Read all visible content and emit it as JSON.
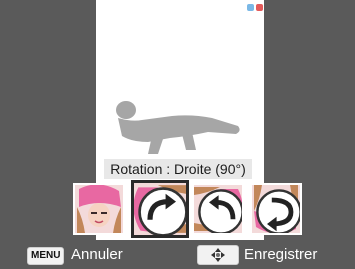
{
  "rotation": {
    "caption": "Rotation : Droite (90°)",
    "selected_index": 1,
    "thumbnails": [
      {
        "name": "thumb-original",
        "rotation": 0,
        "icon": "none"
      },
      {
        "name": "thumb-rotate-right",
        "rotation": 90,
        "icon": "rotate-right-icon"
      },
      {
        "name": "thumb-rotate-left",
        "rotation": -90,
        "icon": "rotate-left-icon"
      },
      {
        "name": "thumb-rotate-180",
        "rotation": 180,
        "icon": "rotate-180-icon"
      }
    ]
  },
  "footer": {
    "menu_key": "MENU",
    "cancel_label": "Annuler",
    "navigate_key_icon": "dpad-icon",
    "save_label": "Enregistrer"
  },
  "colors": {
    "side_panel": "#5a5a5a",
    "preview_bg": "#ffffff",
    "selected_border": "#2a2a2a",
    "accent_corner_blue": "#7ab8e6",
    "accent_corner_red": "#e35a5a"
  }
}
